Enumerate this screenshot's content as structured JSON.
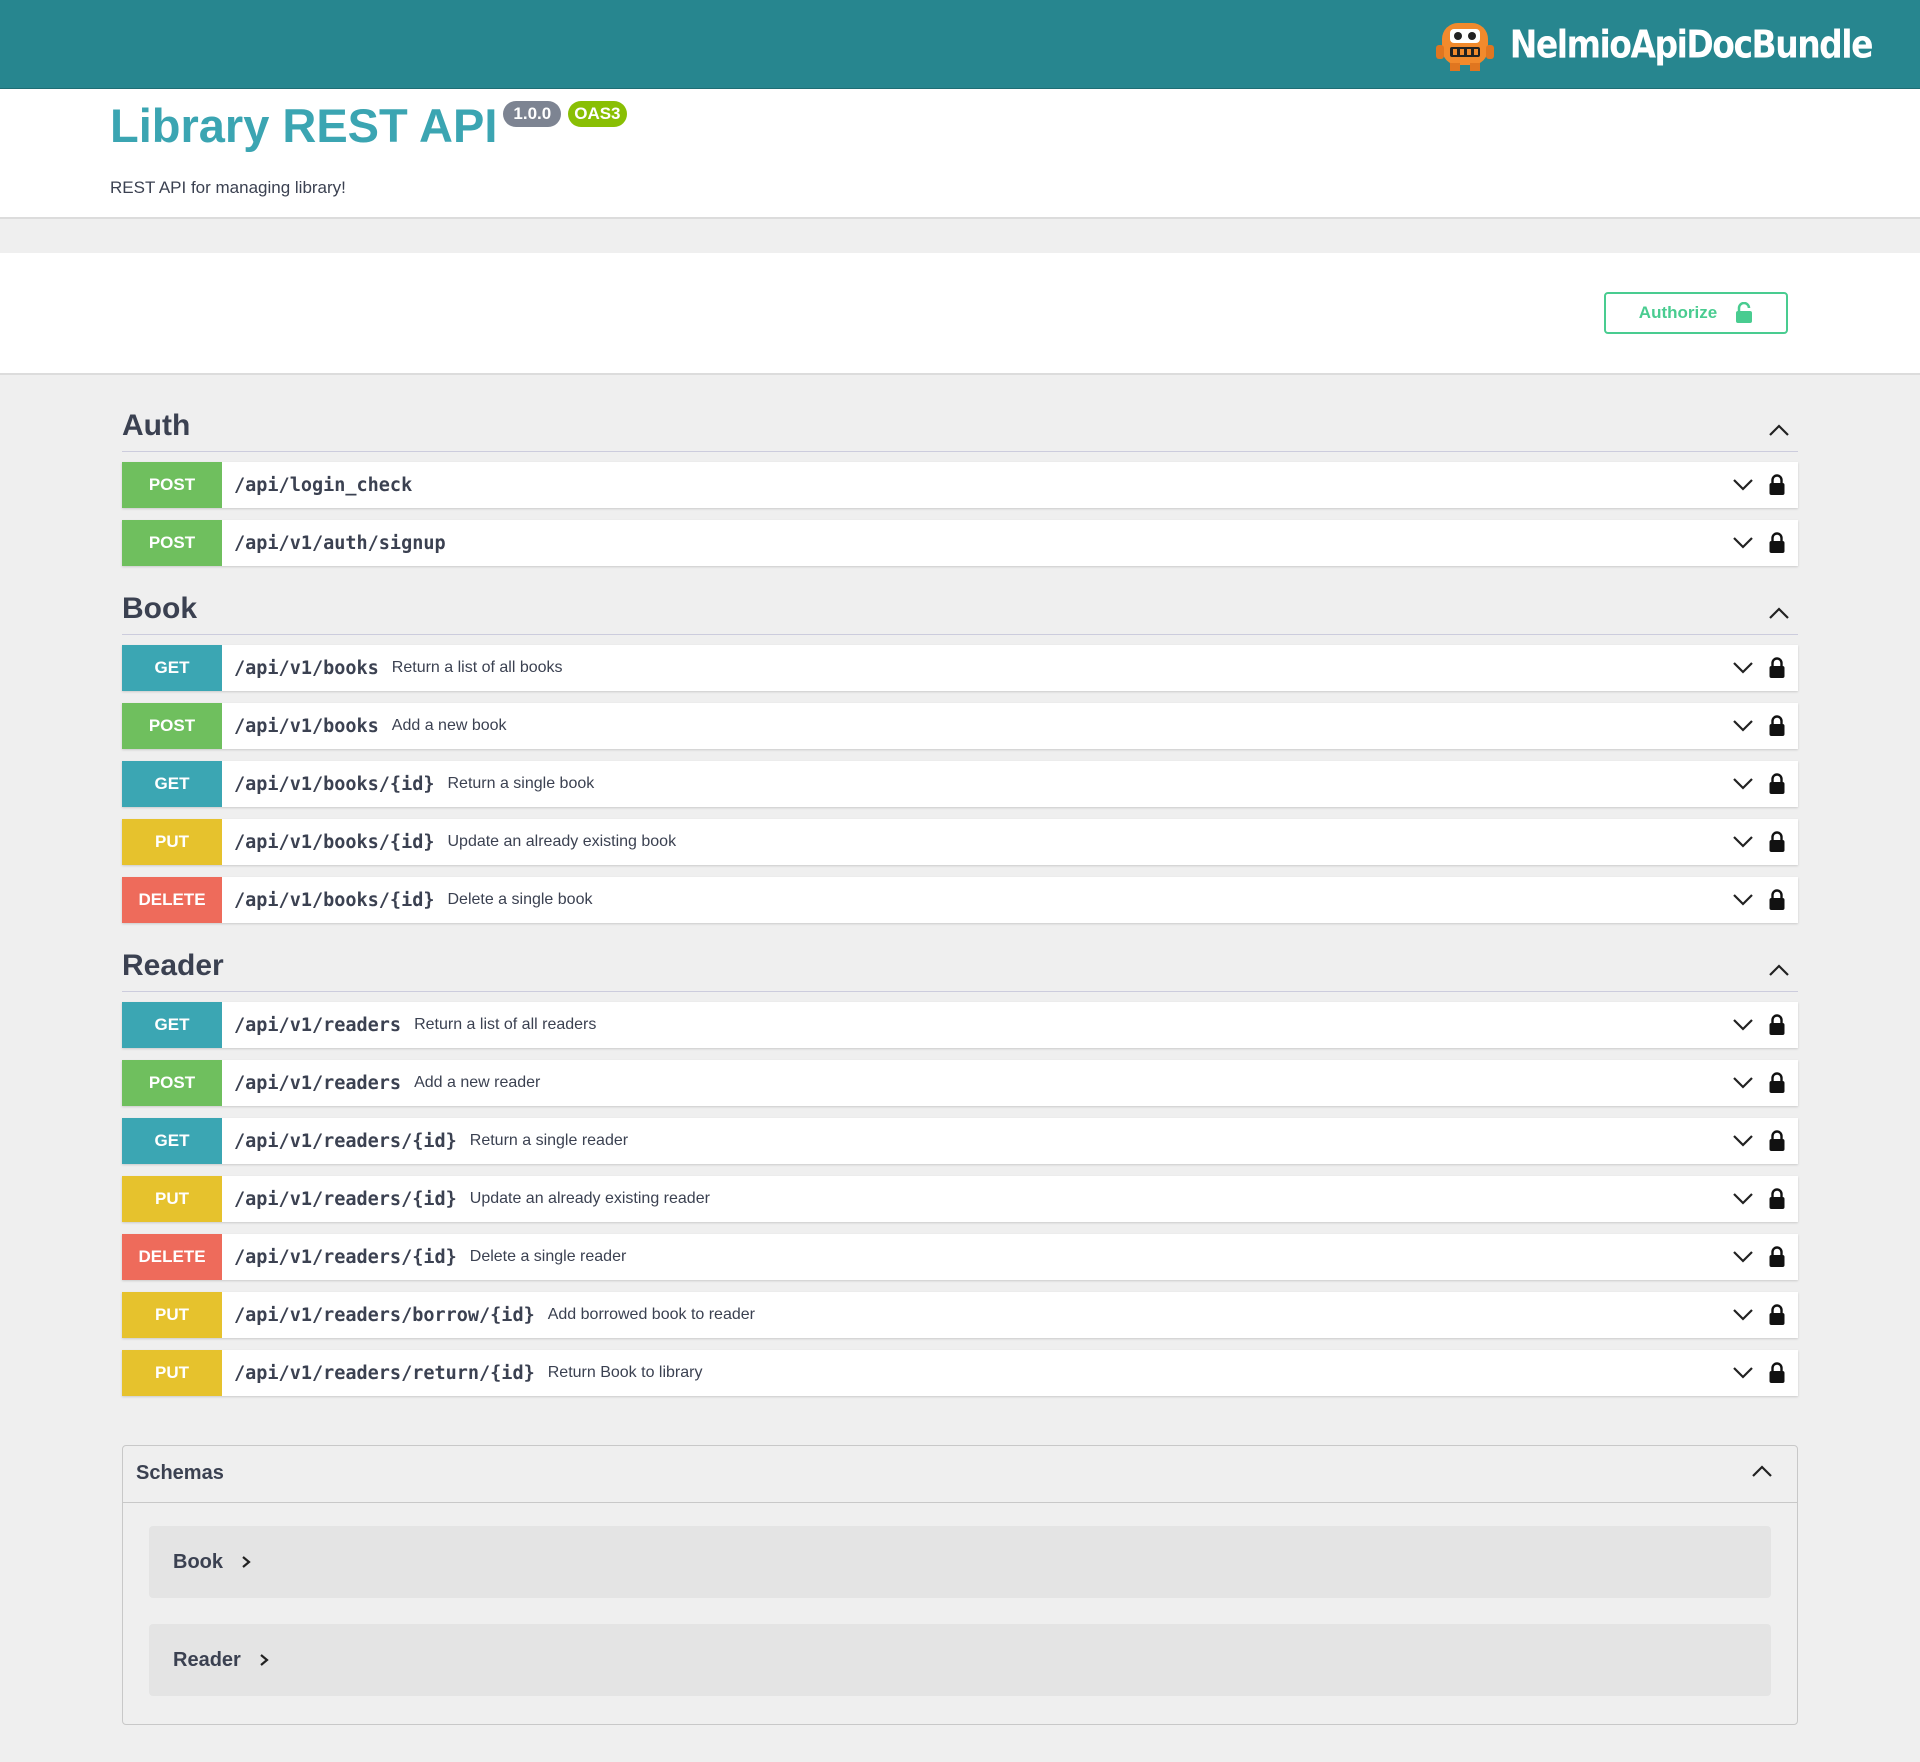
{
  "topbar": {
    "brand_name": "NelmioApiDocBundle",
    "brand_color": "#27868f",
    "logo_icon": "robot-mascot-icon"
  },
  "info": {
    "title": "Library REST API",
    "version": "1.0.0",
    "spec_badge": "OAS3",
    "description": "REST API for managing library!"
  },
  "auth": {
    "authorize_label": "Authorize",
    "icon": "unlock-icon"
  },
  "tags": [
    {
      "name": "Auth",
      "operations": [
        {
          "method": "POST",
          "path": "/api/login_check",
          "summary": ""
        },
        {
          "method": "POST",
          "path": "/api/v1/auth/signup",
          "summary": ""
        }
      ]
    },
    {
      "name": "Book",
      "operations": [
        {
          "method": "GET",
          "path": "/api/v1/books",
          "summary": "Return a list of all books"
        },
        {
          "method": "POST",
          "path": "/api/v1/books",
          "summary": "Add a new book"
        },
        {
          "method": "GET",
          "path": "/api/v1/books/{id}",
          "summary": "Return a single book"
        },
        {
          "method": "PUT",
          "path": "/api/v1/books/{id}",
          "summary": "Update an already existing book"
        },
        {
          "method": "DELETE",
          "path": "/api/v1/books/{id}",
          "summary": "Delete a single book"
        }
      ]
    },
    {
      "name": "Reader",
      "operations": [
        {
          "method": "GET",
          "path": "/api/v1/readers",
          "summary": "Return a list of all readers"
        },
        {
          "method": "POST",
          "path": "/api/v1/readers",
          "summary": "Add a new reader"
        },
        {
          "method": "GET",
          "path": "/api/v1/readers/{id}",
          "summary": "Return a single reader"
        },
        {
          "method": "PUT",
          "path": "/api/v1/readers/{id}",
          "summary": "Update an already existing reader"
        },
        {
          "method": "DELETE",
          "path": "/api/v1/readers/{id}",
          "summary": "Delete a single reader"
        },
        {
          "method": "PUT",
          "path": "/api/v1/readers/borrow/{id}",
          "summary": "Add borrowed book to reader"
        },
        {
          "method": "PUT",
          "path": "/api/v1/readers/return/{id}",
          "summary": "Return Book to library"
        }
      ]
    }
  ],
  "schemas": {
    "title": "Schemas",
    "models": [
      "Book",
      "Reader"
    ]
  },
  "colors": {
    "post": "#6fbf5e",
    "get": "#3ba6b3",
    "put": "#e6c22d",
    "delete": "#ee6b5b",
    "authorize": "#49cc90",
    "title": "#3ba5b2"
  }
}
